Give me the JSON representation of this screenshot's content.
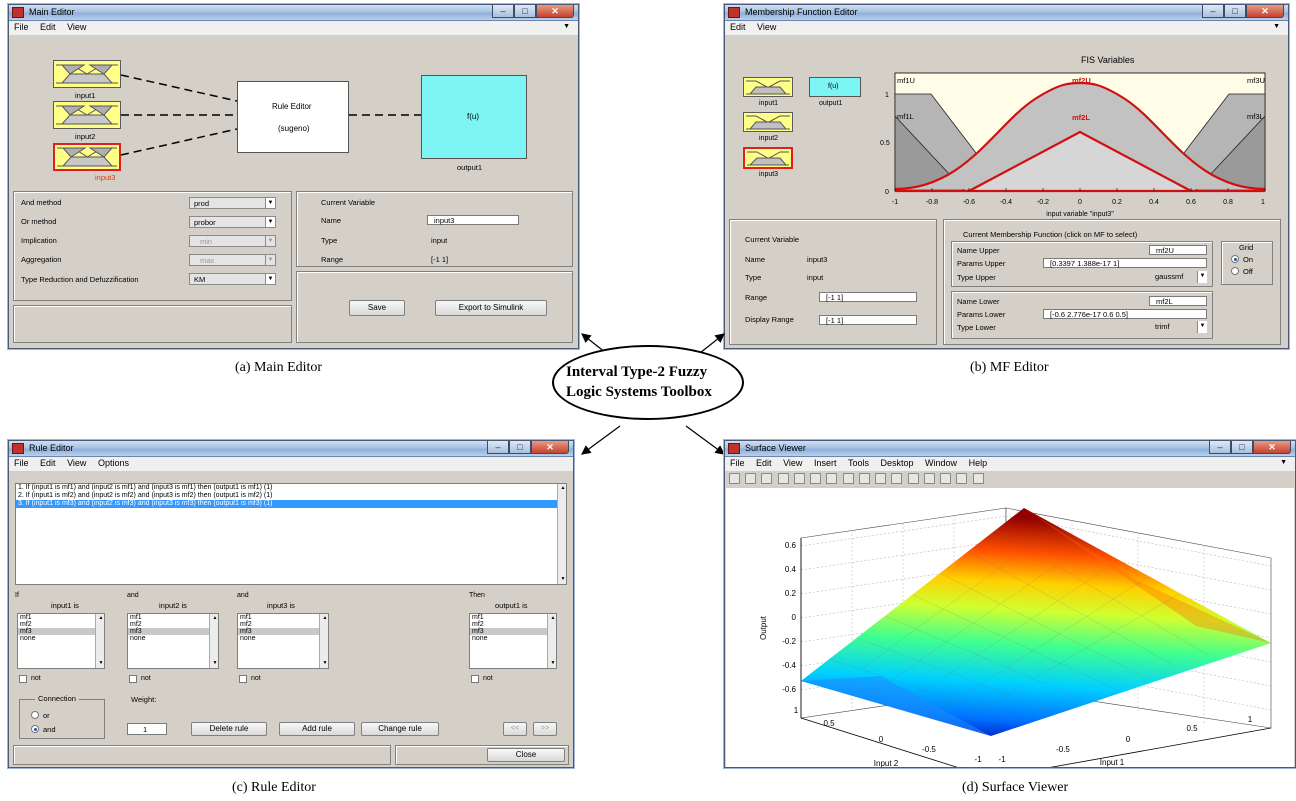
{
  "main_editor": {
    "title": "Main Editor",
    "menu": [
      "File",
      "Edit",
      "View"
    ],
    "inputs": [
      "input1",
      "input2",
      "input3"
    ],
    "rule_box": {
      "title": "Rule Editor",
      "subtitle": "(sugeno)"
    },
    "output_box": {
      "symbol": "f(u)",
      "label": "output1"
    },
    "methods": [
      {
        "label": "And method",
        "value": "prod",
        "enabled": true
      },
      {
        "label": "Or method",
        "value": "probor",
        "enabled": true
      },
      {
        "label": "Implication",
        "value": "min",
        "enabled": false
      },
      {
        "label": "Aggregation",
        "value": "max",
        "enabled": false
      },
      {
        "label": "Type Reduction and Defuzzification",
        "value": "KM",
        "enabled": true
      }
    ],
    "current_variable": {
      "header": "Current Variable",
      "name_label": "Name",
      "name": "input3",
      "type_label": "Type",
      "type": "input",
      "range_label": "Range",
      "range": "[-1 1]"
    },
    "save_button": "Save",
    "export_button": "Export to Simulink",
    "caption": "(a) Main Editor"
  },
  "mf_editor": {
    "title": "Membership Function Editor",
    "menu": [
      "Edit",
      "View"
    ],
    "fis_vars": {
      "in1": "input1",
      "in2": "input2",
      "in3": "input3",
      "out": "output1",
      "out_symbol": "f(u)"
    },
    "plot": {
      "title": "FIS Variables",
      "xlabel": "input variable \"input3\"",
      "xticks": [
        "-1",
        "-0.8",
        "-0.6",
        "-0.4",
        "-0.2",
        "0",
        "0.2",
        "0.4",
        "0.6",
        "0.8",
        "1"
      ],
      "yticks": [
        "0",
        "0.5",
        "1"
      ],
      "labels": {
        "mf1U": "mf1U",
        "mf2U": "mf2U",
        "mf3U": "mf3U",
        "mf1L": "mf1L",
        "mf2L": "mf2L",
        "mf3L": "mf3L"
      }
    },
    "current_variable": {
      "header": "Current Variable",
      "name_label": "Name",
      "name": "input3",
      "type_label": "Type",
      "type": "input",
      "range_label": "Range",
      "range": "[-1 1]",
      "display_range_label": "Display Range",
      "display_range": "[-1 1]"
    },
    "current_mf": {
      "header": "Current Membership Function (click on MF to select)",
      "name_upper_label": "Name Upper",
      "name_upper": "mf2U",
      "params_upper_label": "Params Upper",
      "params_upper": "[0.3397 1.388e-17 1]",
      "type_upper_label": "Type Upper",
      "type_upper": "gaussmf",
      "name_lower_label": "Name Lower",
      "name_lower": "mf2L",
      "params_lower_label": "Params Lower",
      "params_lower": "[-0.6 2.776e-17 0.6 0.5]",
      "type_lower_label": "Type Lower",
      "type_lower": "trimf"
    },
    "grid": {
      "label": "Grid",
      "on": "On",
      "off": "Off"
    },
    "caption": "(b) MF Editor"
  },
  "center": {
    "line1": "Interval Type-2 Fuzzy",
    "line2": "Logic Systems Toolbox"
  },
  "rule_editor": {
    "title": "Rule Editor",
    "menu": [
      "File",
      "Edit",
      "View",
      "Options"
    ],
    "rules": [
      "1. If (input1 is mf1) and (input2 is mf1) and (input3 is mf1) then (output1 is mf1) (1)",
      "2. If (input1 is mf2) and (input2 is mf2) and (input3 is mf2) then (output1 is mf2) (1)",
      "3. If (input1 is mf3) and (input2 is mf3) and (input3 is mf3) then (output1 is mf3) (1)"
    ],
    "columns": [
      {
        "conn": "If",
        "head": "input1 is"
      },
      {
        "conn": "and",
        "head": "input2 is"
      },
      {
        "conn": "and",
        "head": "input3 is"
      },
      {
        "conn": "Then",
        "head": "output1 is"
      }
    ],
    "options": [
      "mf1",
      "mf2",
      "mf3",
      "none"
    ],
    "not_label": "not",
    "connection": {
      "label": "Connection",
      "or": "or",
      "and": "and"
    },
    "weight_label": "Weight:",
    "weight_value": "1",
    "delete_button": "Delete rule",
    "add_button": "Add rule",
    "change_button": "Change rule",
    "prev_button": "<<",
    "next_button": ">>",
    "close_button": "Close",
    "caption": "(c) Rule Editor"
  },
  "surface_viewer": {
    "title": "Surface Viewer",
    "menu": [
      "File",
      "Edit",
      "View",
      "Insert",
      "Tools",
      "Desktop",
      "Window",
      "Help"
    ],
    "zlabel": "Output",
    "xlabel": "Input 1",
    "ylabel": "Input 2",
    "zticks": [
      "0.6",
      "0.4",
      "0.2",
      "0",
      "-0.2",
      "-0.4",
      "-0.6"
    ],
    "x_ticks": [
      "-1",
      "-0.5",
      "0",
      "0.5",
      "1"
    ],
    "y_ticks": [
      "1",
      "0.5",
      "0",
      "-0.5",
      "-1"
    ],
    "caption": "(d) Surface Viewer"
  },
  "colors": {
    "accent_red": "#d01010",
    "mf_fill": "#ffff88",
    "output_cyan": "#7df5f5",
    "selection": "#3399ff"
  }
}
